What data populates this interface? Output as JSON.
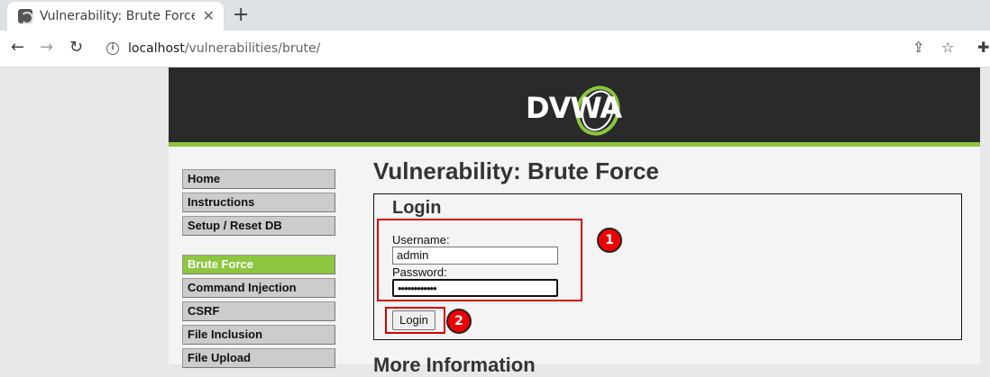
{
  "browser": {
    "tab_title": "Vulnerability: Brute Force",
    "close_glyph": "✕",
    "new_tab_glyph": "+",
    "url_host": "localhost",
    "url_path": "/vulnerabilities/brute/",
    "info_glyph": "i",
    "back_glyph": "←",
    "forward_glyph": "→",
    "reload_glyph": "↻",
    "share_glyph": "⇪",
    "star_glyph": "☆",
    "ext_glyph": "✚"
  },
  "header": {
    "logo_text": "DVWA",
    "accent_color": "#8dc63f"
  },
  "menu": {
    "items": [
      {
        "label": "Home"
      },
      {
        "label": "Instructions"
      },
      {
        "label": "Setup / Reset DB"
      }
    ],
    "items2": [
      {
        "label": "Brute Force",
        "active": true
      },
      {
        "label": "Command Injection"
      },
      {
        "label": "CSRF"
      },
      {
        "label": "File Inclusion"
      },
      {
        "label": "File Upload"
      }
    ]
  },
  "main": {
    "title": "Vulnerability: Brute Force",
    "login_heading": "Login",
    "username_label": "Username:",
    "username_value": "admin",
    "password_label": "Password:",
    "password_value": "••••••••••••",
    "login_button": "Login",
    "more_heading": "More Information"
  },
  "annotations": {
    "badge1": "1",
    "badge2": "2",
    "highlight_color": "#d60000"
  }
}
